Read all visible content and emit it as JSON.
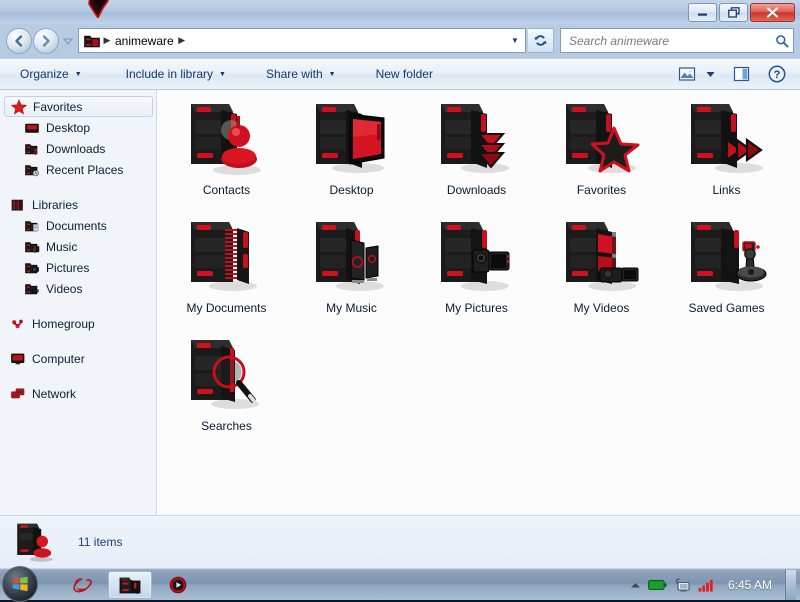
{
  "window": {
    "titlebar_logo_icon": "red-folder-logo-icon",
    "buttons": {
      "minimize": "minimize-icon",
      "maximize": "restore-icon",
      "close": "close-icon"
    }
  },
  "nav": {
    "back_icon": "back-arrow-icon",
    "forward_icon": "forward-arrow-icon",
    "history_dropdown_icon": "chevron-down-icon",
    "refresh_icon": "refresh-icon"
  },
  "address": {
    "folder_icon": "red-folder-icon",
    "crumbs": [
      "animeware"
    ],
    "dropdown_icon": "chevron-down-icon"
  },
  "search": {
    "placeholder": "Search animeware",
    "value": "",
    "icon": "search-icon"
  },
  "toolbar": {
    "items": [
      {
        "label": "Organize",
        "has_caret": true
      },
      {
        "label": "Include in library",
        "has_caret": true
      },
      {
        "label": "Share with",
        "has_caret": true
      },
      {
        "label": "New folder",
        "has_caret": false
      }
    ],
    "right_icons": [
      "change-view-icon",
      "view-dropdown-caret-icon",
      "preview-pane-icon",
      "help-icon"
    ]
  },
  "sidebar": {
    "groups": [
      {
        "header": {
          "label": "Favorites",
          "icon": "red-star-icon",
          "selected": true
        },
        "items": [
          {
            "label": "Desktop",
            "icon": "desktop-folder-icon"
          },
          {
            "label": "Downloads",
            "icon": "downloads-folder-icon"
          },
          {
            "label": "Recent Places",
            "icon": "recent-places-icon"
          }
        ]
      },
      {
        "header": {
          "label": "Libraries",
          "icon": "libraries-icon",
          "selected": false
        },
        "items": [
          {
            "label": "Documents",
            "icon": "documents-folder-icon"
          },
          {
            "label": "Music",
            "icon": "music-folder-icon"
          },
          {
            "label": "Pictures",
            "icon": "pictures-folder-icon"
          },
          {
            "label": "Videos",
            "icon": "videos-folder-icon"
          }
        ]
      },
      {
        "header": {
          "label": "Homegroup",
          "icon": "homegroup-icon",
          "selected": false
        },
        "items": []
      },
      {
        "header": {
          "label": "Computer",
          "icon": "computer-icon",
          "selected": false
        },
        "items": []
      },
      {
        "header": {
          "label": "Network",
          "icon": "network-icon",
          "selected": false
        },
        "items": []
      }
    ]
  },
  "files": [
    {
      "label": "Contacts",
      "icon": "contacts-folder-icon"
    },
    {
      "label": "Desktop",
      "icon": "desktop-folder-icon"
    },
    {
      "label": "Downloads",
      "icon": "downloads-folder-icon"
    },
    {
      "label": "Favorites",
      "icon": "favorites-folder-icon"
    },
    {
      "label": "Links",
      "icon": "links-folder-icon"
    },
    {
      "label": "My Documents",
      "icon": "my-documents-folder-icon"
    },
    {
      "label": "My Music",
      "icon": "my-music-folder-icon"
    },
    {
      "label": "My Pictures",
      "icon": "my-pictures-folder-icon"
    },
    {
      "label": "My Videos",
      "icon": "my-videos-folder-icon"
    },
    {
      "label": "Saved Games",
      "icon": "saved-games-folder-icon"
    },
    {
      "label": "Searches",
      "icon": "searches-folder-icon"
    }
  ],
  "status": {
    "icon": "contacts-folder-icon",
    "text": "11 items"
  },
  "taskbar": {
    "start_icon": "windows-start-orb-icon",
    "buttons": [
      {
        "icon": "internet-explorer-icon",
        "active": false
      },
      {
        "icon": "windows-explorer-icon",
        "active": true
      },
      {
        "icon": "media-player-icon",
        "active": false
      }
    ],
    "tray": {
      "overflow_icon": "chevron-up-icon",
      "battery_icon": "battery-icon",
      "network_icon": "network-tray-icon",
      "signal_icon": "signal-bars-icon",
      "clock": "6:45 AM",
      "show_desktop_icon": "show-desktop-icon"
    }
  },
  "colors": {
    "accent_red": "#cc0000",
    "folder_black": "#1a1a1a",
    "frame_blue": "#a9c2de",
    "content_bg": "#fcfcfc"
  }
}
